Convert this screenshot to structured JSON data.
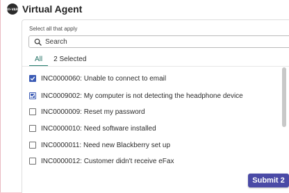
{
  "header": {
    "title": "Virtual Agent",
    "avatar_text": "UI·VAR"
  },
  "form": {
    "instruction": "Select all that apply",
    "search_placeholder": "Search"
  },
  "tabs": [
    {
      "label": "All",
      "active": true
    },
    {
      "label": "2 Selected",
      "active": false
    }
  ],
  "items": [
    {
      "label": "INC0000060: Unable to connect to email",
      "checked": true
    },
    {
      "label": "INC0009002: My computer is not detecting the headphone device",
      "checked": true
    },
    {
      "label": "INC0000009: Reset my password",
      "checked": false
    },
    {
      "label": "INC0000010: Need software installed",
      "checked": false
    },
    {
      "label": "INC0000011: Need new Blackberry set up",
      "checked": false
    },
    {
      "label": "INC0000012: Customer didn't receive eFax",
      "checked": false
    }
  ],
  "actions": {
    "submit_label": "Submit 2"
  },
  "colors": {
    "accent_tab": "#1f7a6b",
    "checkbox_checked": "#3b5bb5",
    "submit_button": "#4a4aa6",
    "page_background": "#f7c9d0"
  }
}
